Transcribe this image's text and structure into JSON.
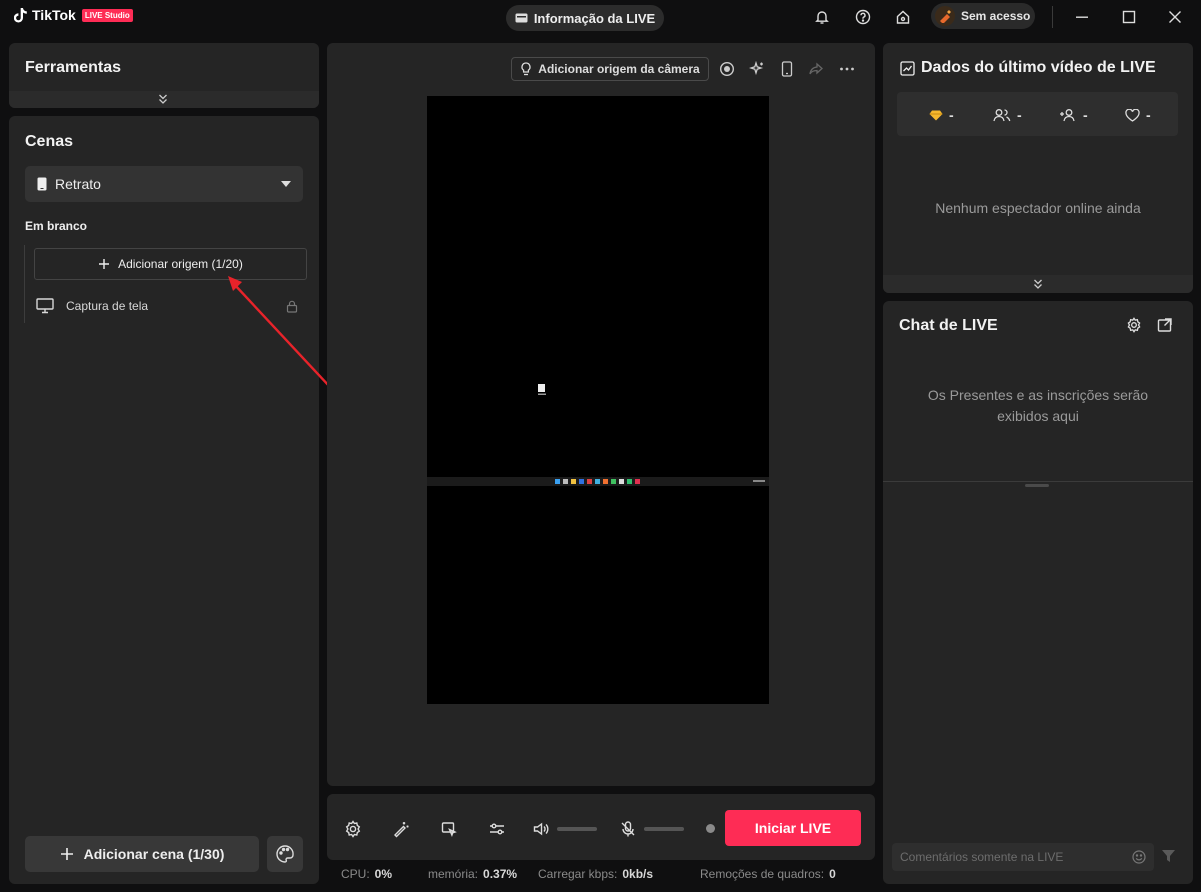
{
  "app": {
    "logo_text": "TikTok",
    "badge": "LIVE Studio"
  },
  "titlebar": {
    "live_info": "Informação da LIVE",
    "account": "Sem acesso"
  },
  "tools": {
    "title": "Ferramentas"
  },
  "scenes": {
    "title": "Cenas",
    "layout_selected": "Retrato",
    "scene_name": "Em branco",
    "add_source": "Adicionar origem (1/20)",
    "sources": [
      {
        "label": "Captura de tela"
      }
    ],
    "add_scene": "Adicionar cena (1/30)"
  },
  "preview": {
    "add_camera": "Adicionar origem da câmera"
  },
  "controls": {
    "go_live": "Iniciar LIVE"
  },
  "stats": {
    "cpu_label": "CPU:",
    "cpu_value": "0%",
    "memory_label": "memória:",
    "memory_value": "0.37%",
    "upload_label": "Carregar kbps:",
    "upload_value": "0kb/s",
    "dropped_label": "Remoções de quadros:",
    "dropped_value": "0"
  },
  "last_live": {
    "title": "Dados do último vídeo de LIVE",
    "gems": "-",
    "viewers": "-",
    "new_followers": "-",
    "likes": "-",
    "empty_text": "Nenhum espectador online ainda"
  },
  "chat": {
    "title": "Chat de LIVE",
    "empty_line1": "Os Presentes e as inscrições serão",
    "empty_line2": "exibidos aqui",
    "input_placeholder": "Comentários somente na LIVE"
  },
  "colors": {
    "accent": "#fe2c55",
    "panel": "#252525",
    "background": "#0f0f10"
  }
}
